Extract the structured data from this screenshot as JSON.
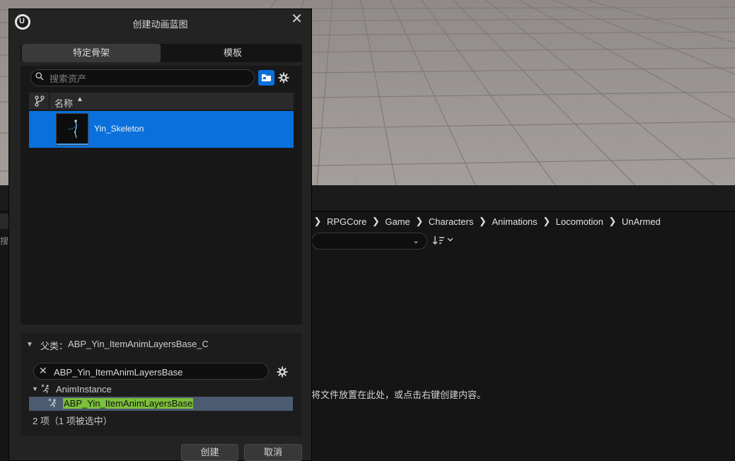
{
  "background": {
    "breadcrumb": [
      "RPGCore",
      "Game",
      "Characters",
      "Animations",
      "Locomotion",
      "UnArmed"
    ],
    "empty_hint": "将文件放置在此处，或点击右键创建内容。",
    "left_sliver_text": "搜"
  },
  "dialog": {
    "title": "创建动画蓝图",
    "tabs": [
      {
        "label": "特定骨架",
        "active": true
      },
      {
        "label": "模板",
        "active": false
      }
    ],
    "search": {
      "placeholder": "搜索资产",
      "value": ""
    },
    "columns": {
      "name": "名称"
    },
    "assets": [
      {
        "label": "Yin_Skeleton",
        "selected": true
      }
    ],
    "parent": {
      "label": "父类：",
      "value": "ABP_Yin_ItemAnimLayersBase_C",
      "filter_value": "ABP_Yin_ItemAnimLayersBase",
      "tree": [
        {
          "label": "AnimInstance",
          "expanded": true
        },
        {
          "label": "ABP_Yin_ItemAnimLayersBase",
          "selected": true
        }
      ],
      "count": "2 项（1 项被选中）"
    },
    "buttons": {
      "create": "创建",
      "cancel": "取消"
    }
  },
  "colors": {
    "accent": "#0a70dc",
    "highlight": "#7bbf3a",
    "selection_row": "#4a5b72"
  }
}
